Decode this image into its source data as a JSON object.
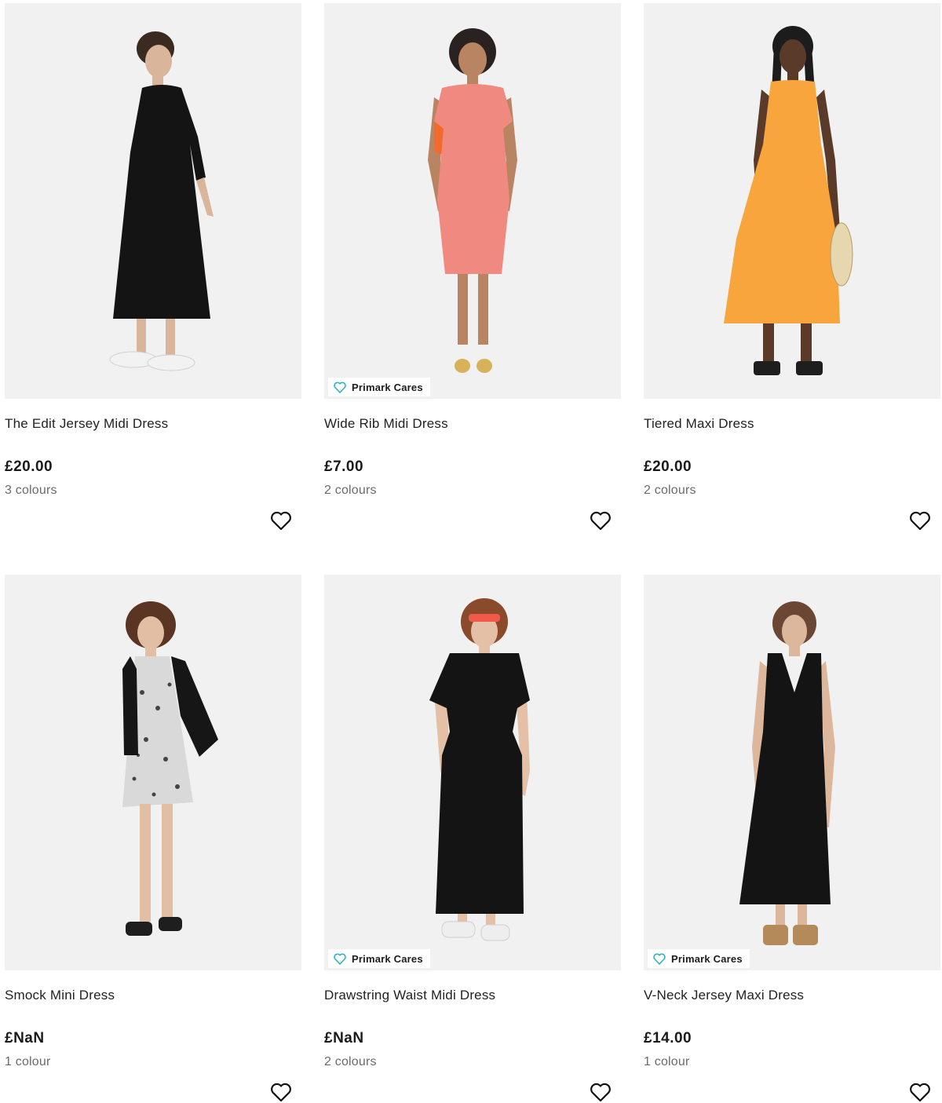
{
  "products": [
    {
      "name": "The Edit Jersey Midi Dress",
      "price": "£20.00",
      "colours": "3 colours",
      "badge": "",
      "dress_color": "#141414",
      "shoe_color": "#f2f2f2"
    },
    {
      "name": "Wide Rib Midi Dress",
      "price": "£7.00",
      "colours": "2 colours",
      "badge": "Primark Cares",
      "dress_color": "#f08a80",
      "shoe_color": "#d8b25a"
    },
    {
      "name": "Tiered Maxi Dress",
      "price": "£20.00",
      "colours": "2 colours",
      "badge": "",
      "dress_color": "#f7a53c",
      "shoe_color": "#1e1e1e"
    },
    {
      "name": "Smock Mini Dress",
      "price": "£NaN",
      "colours": "1 colour",
      "badge": "",
      "dress_color": "#d9d9d9",
      "shoe_color": "#1e1e1e"
    },
    {
      "name": "Drawstring Waist Midi Dress",
      "price": "£NaN",
      "colours": "2 colours",
      "badge": "Primark Cares",
      "dress_color": "#141414",
      "shoe_color": "#eeeeee"
    },
    {
      "name": "V-Neck Jersey Maxi Dress",
      "price": "£14.00",
      "colours": "1 colour",
      "badge": "Primark Cares",
      "dress_color": "#141414",
      "shoe_color": "#b58a5a"
    }
  ],
  "icons": {
    "favourite": "heart-outline-icon",
    "badge": "heart-badge-icon"
  },
  "colors": {
    "badge_accent": "#2bb3c0",
    "image_bg": "#f1f1f1"
  }
}
